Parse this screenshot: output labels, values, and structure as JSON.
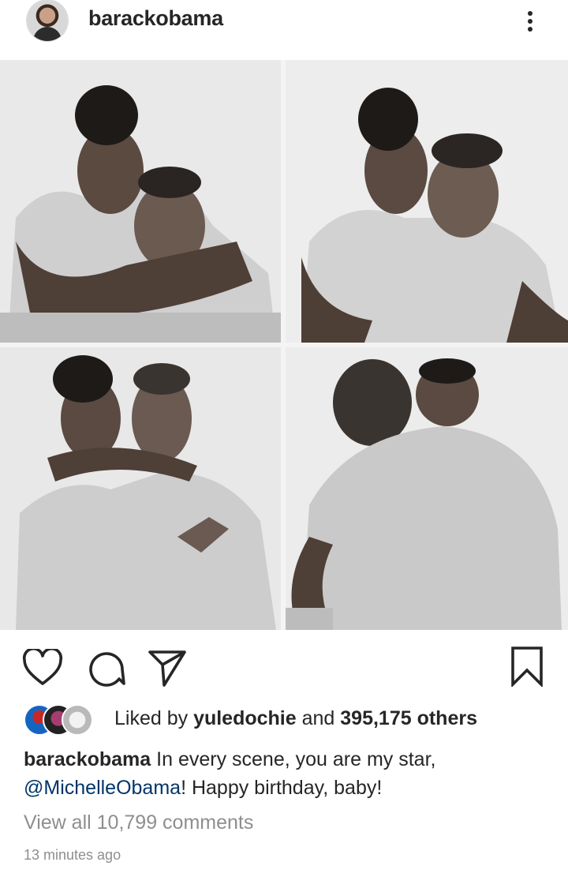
{
  "post": {
    "username": "barackobama",
    "more_icon": "more-vertical-icon"
  },
  "photos": [
    {
      "alt_icon": "photo-hug"
    },
    {
      "alt_icon": "photo-kiss"
    },
    {
      "alt_icon": "photo-peace-sign"
    },
    {
      "alt_icon": "photo-embrace"
    }
  ],
  "actions": {
    "like_icon": "heart-icon",
    "comment_icon": "comment-icon",
    "share_icon": "send-icon",
    "save_icon": "bookmark-icon"
  },
  "likes": {
    "prefix": "Liked by ",
    "user": "yuledochie",
    "middle": " and ",
    "count": "395,175 others"
  },
  "caption": {
    "username": "barackobama",
    "text_start": " In every scene, you are my star, ",
    "mention": "@MichelleObama",
    "text_end": "! Happy birthday, baby!"
  },
  "comments_link": "View all 10,799 comments",
  "timestamp": "13 minutes ago"
}
